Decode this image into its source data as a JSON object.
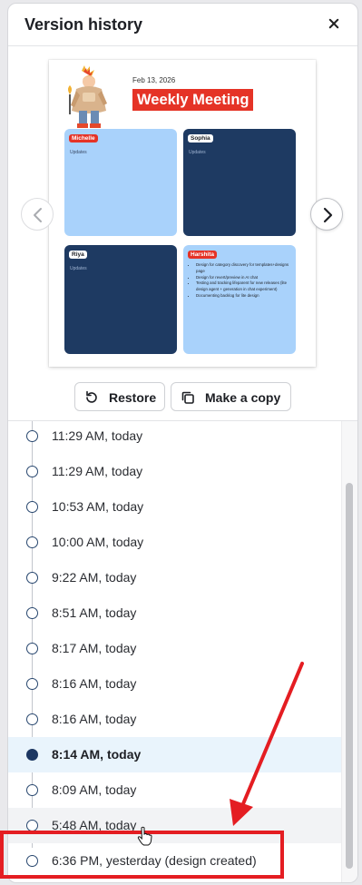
{
  "panel": {
    "title": "Version history"
  },
  "preview": {
    "date": "Feb 13, 2026",
    "headline": "Weekly Meeting",
    "cards": [
      {
        "name": "Michelle",
        "subtitle": "Updates"
      },
      {
        "name": "Sophia",
        "subtitle": "Updates"
      },
      {
        "name": "Riya",
        "subtitle": "Updates"
      },
      {
        "name": "Harshita",
        "bullets": [
          "Design for category discovery for templates+designs page",
          "Design for revert/preview in AI chat",
          "Testing and tracking lifeparent for new releases (lite design agent + generation in chat experiment)",
          "Documenting backlog for lite design"
        ]
      }
    ]
  },
  "actions": {
    "restore_label": "Restore",
    "copy_label": "Make a copy"
  },
  "versions": [
    {
      "label": "11:29 AM, today"
    },
    {
      "label": "11:29 AM, today"
    },
    {
      "label": "10:53 AM, today"
    },
    {
      "label": "10:00 AM, today"
    },
    {
      "label": "9:22 AM, today"
    },
    {
      "label": "8:51 AM, today"
    },
    {
      "label": "8:17 AM, today"
    },
    {
      "label": "8:16 AM, today"
    },
    {
      "label": "8:16 AM, today"
    },
    {
      "label": "8:14 AM, today",
      "selected": true
    },
    {
      "label": "8:09 AM, today"
    },
    {
      "label": "5:48 AM, today"
    },
    {
      "label": "6:36 PM, yesterday (design created)"
    }
  ],
  "annotation_color": "#e41d22",
  "accent_color": "#1c3762"
}
